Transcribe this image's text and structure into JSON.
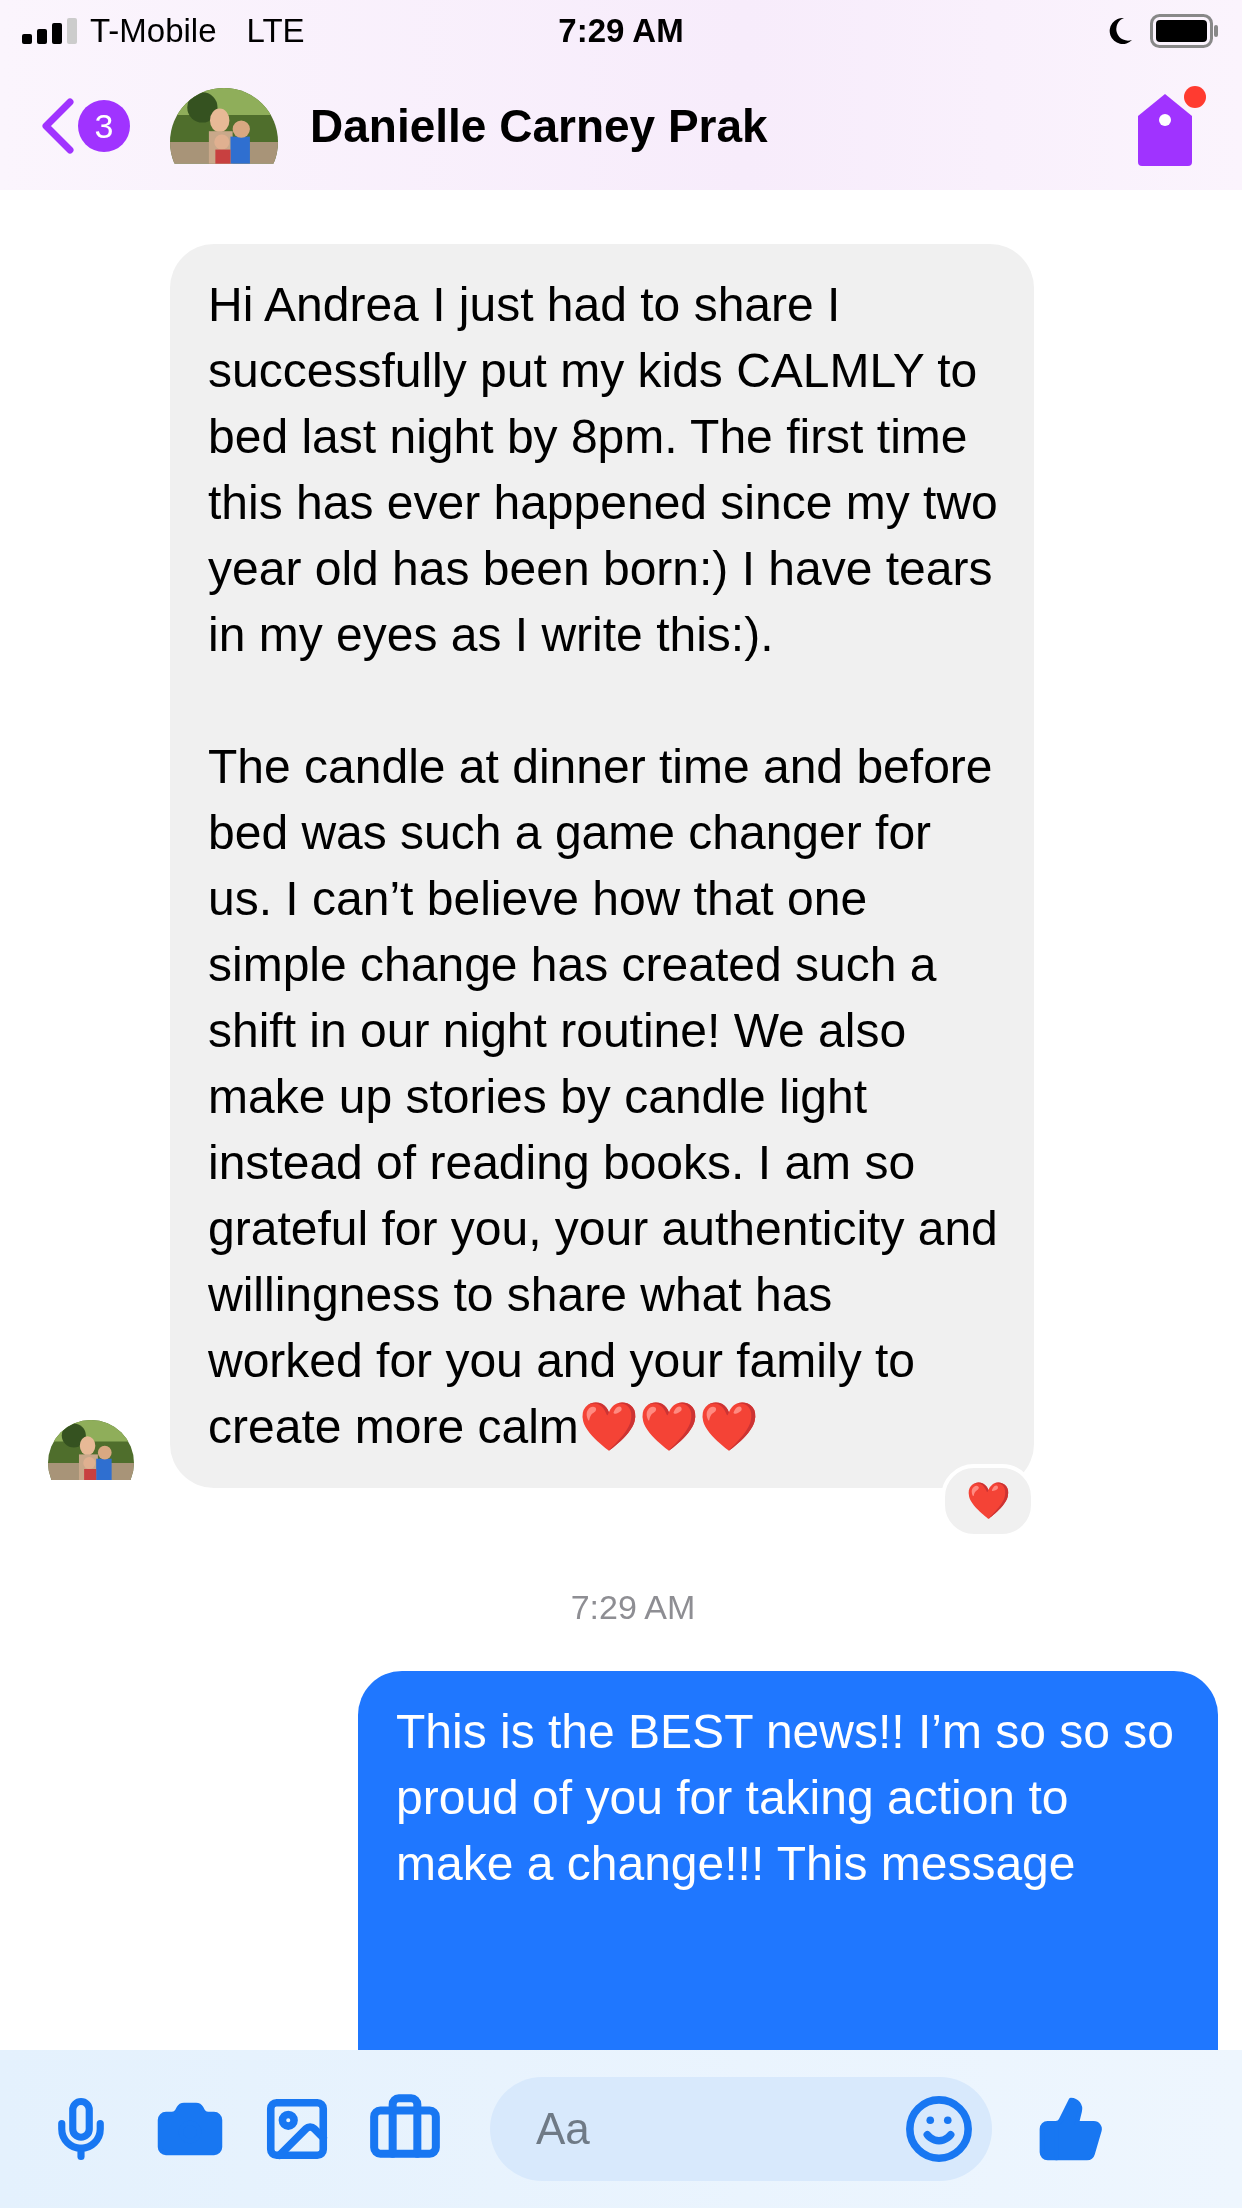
{
  "status_bar": {
    "carrier": "T-Mobile",
    "network": "LTE",
    "time": "7:29 AM"
  },
  "header": {
    "back_count": "3",
    "contact_name": "Danielle Carney Prak",
    "tag_notification": true
  },
  "messages": [
    {
      "kind": "incoming",
      "paragraphs": [
        "Hi Andrea I just had to share I successfully put my kids CALMLY to bed last night by 8pm. The first time this has ever happened since my two year old has been born:) I have tears in my eyes as I write this:).",
        "The candle at dinner time and before bed was such a game changer for us. I can’t believe how that one simple change has created such a shift in our night routine! We also make up stories by candle light instead of reading books. I am so grateful for you, your authenticity and willingness to share what has worked for you and your family to create more calm❤️❤️❤️"
      ],
      "reaction": "❤️"
    },
    {
      "kind": "timestamp",
      "text": "7:29 AM"
    },
    {
      "kind": "outgoing",
      "paragraphs": [
        "This is the BEST news!! I’m so so so proud of you for taking action to make a change!!! This message"
      ]
    }
  ],
  "composer": {
    "placeholder": "Aa"
  }
}
